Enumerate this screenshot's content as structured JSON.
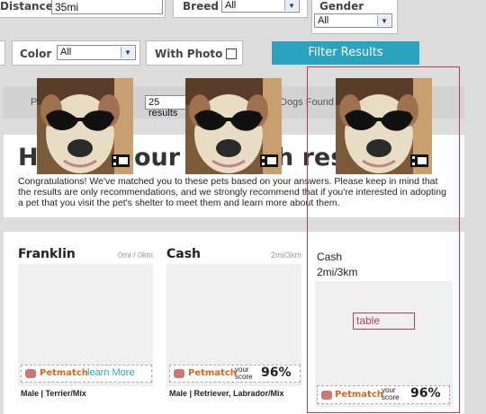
{
  "filters": {
    "distance_label": "Distance",
    "distance_value": "35mi",
    "breed_label": "Breed",
    "breed_value": "All",
    "gender_label": "Gender",
    "gender_value": "All",
    "color_label": "Color",
    "color_value": "All",
    "photo_label": "With Photo",
    "submit_label": "Filter Results"
  },
  "results_bar": {
    "prefix_fragment": "P",
    "per_page_value": "25 results",
    "count_fragment": "Dogs Found"
  },
  "heading": {
    "title_left": "H",
    "title_mid": "our P",
    "title_right": "h res",
    "intro": "Congratulations! We've matched you to these pets based on your answers. Please keep in mind that the results are only recommendations, and we strongly recommend that if you're interested in adopting a pet that you visit the pet's shelter to meet them and learn more about them."
  },
  "cards": [
    {
      "name": "Franklin",
      "distance": "0mi / 0km",
      "link": "learn More",
      "meta": "Male | Terrier/Mix"
    },
    {
      "name": "Cash",
      "distance": "2mi/3km",
      "score_label": "your score",
      "score": "96%",
      "meta": "Male | Retriever, Labrador/Mix"
    }
  ],
  "overlay": {
    "name": "Cash",
    "distance": "2mi/3km",
    "table_label": "table",
    "score_label": "your score",
    "score": "96%"
  },
  "brand": {
    "logo": "Petmatch",
    "accent": "#2ba3bf",
    "highlight": "#b04050"
  },
  "icons": [
    "film-strip-icon",
    "checkbox-icon",
    "dropdown-arrow-icon",
    "paw-icon"
  ]
}
